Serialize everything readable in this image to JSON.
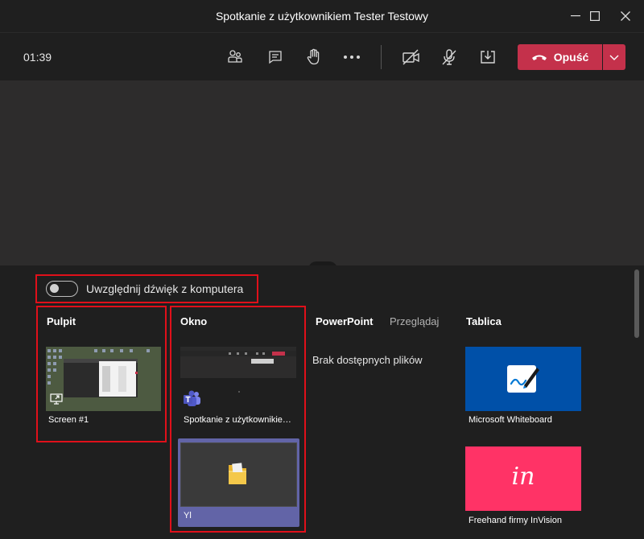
{
  "window": {
    "title": "Spotkanie z użytkownikiem Tester Testowy"
  },
  "toolbar": {
    "timer": "01:39",
    "leave_label": "Opuść",
    "icons": [
      "participants-icon",
      "chat-icon",
      "raise-hand-icon",
      "more-options-icon",
      "camera-off-icon",
      "mic-off-icon",
      "share-tray-icon",
      "phone-hangup-icon",
      "chevron-down-icon"
    ]
  },
  "share_tray": {
    "audio_toggle_label": "Uwzględnij dźwięk z komputera",
    "desktop": {
      "title": "Pulpit",
      "items": [
        {
          "label": "Screen #1"
        }
      ]
    },
    "window": {
      "title": "Okno",
      "items": [
        {
          "label": "Spotkanie z użytkownikiem Tester Testowy"
        },
        {
          "label": "Yl"
        }
      ]
    },
    "powerpoint": {
      "title": "PowerPoint",
      "browse_label": "Przeglądaj",
      "empty_text": "Brak dostępnych plików"
    },
    "whiteboard": {
      "title": "Tablica",
      "items": [
        {
          "label": "Microsoft Whiteboard",
          "color": "#0050a8"
        },
        {
          "label": "Freehand firmy InVision",
          "color": "#ff3366",
          "logo_text": "in"
        }
      ]
    }
  },
  "colors": {
    "leave": "#c4314b",
    "highlight": "#e0101a",
    "selected_tile": "#6264a7"
  }
}
